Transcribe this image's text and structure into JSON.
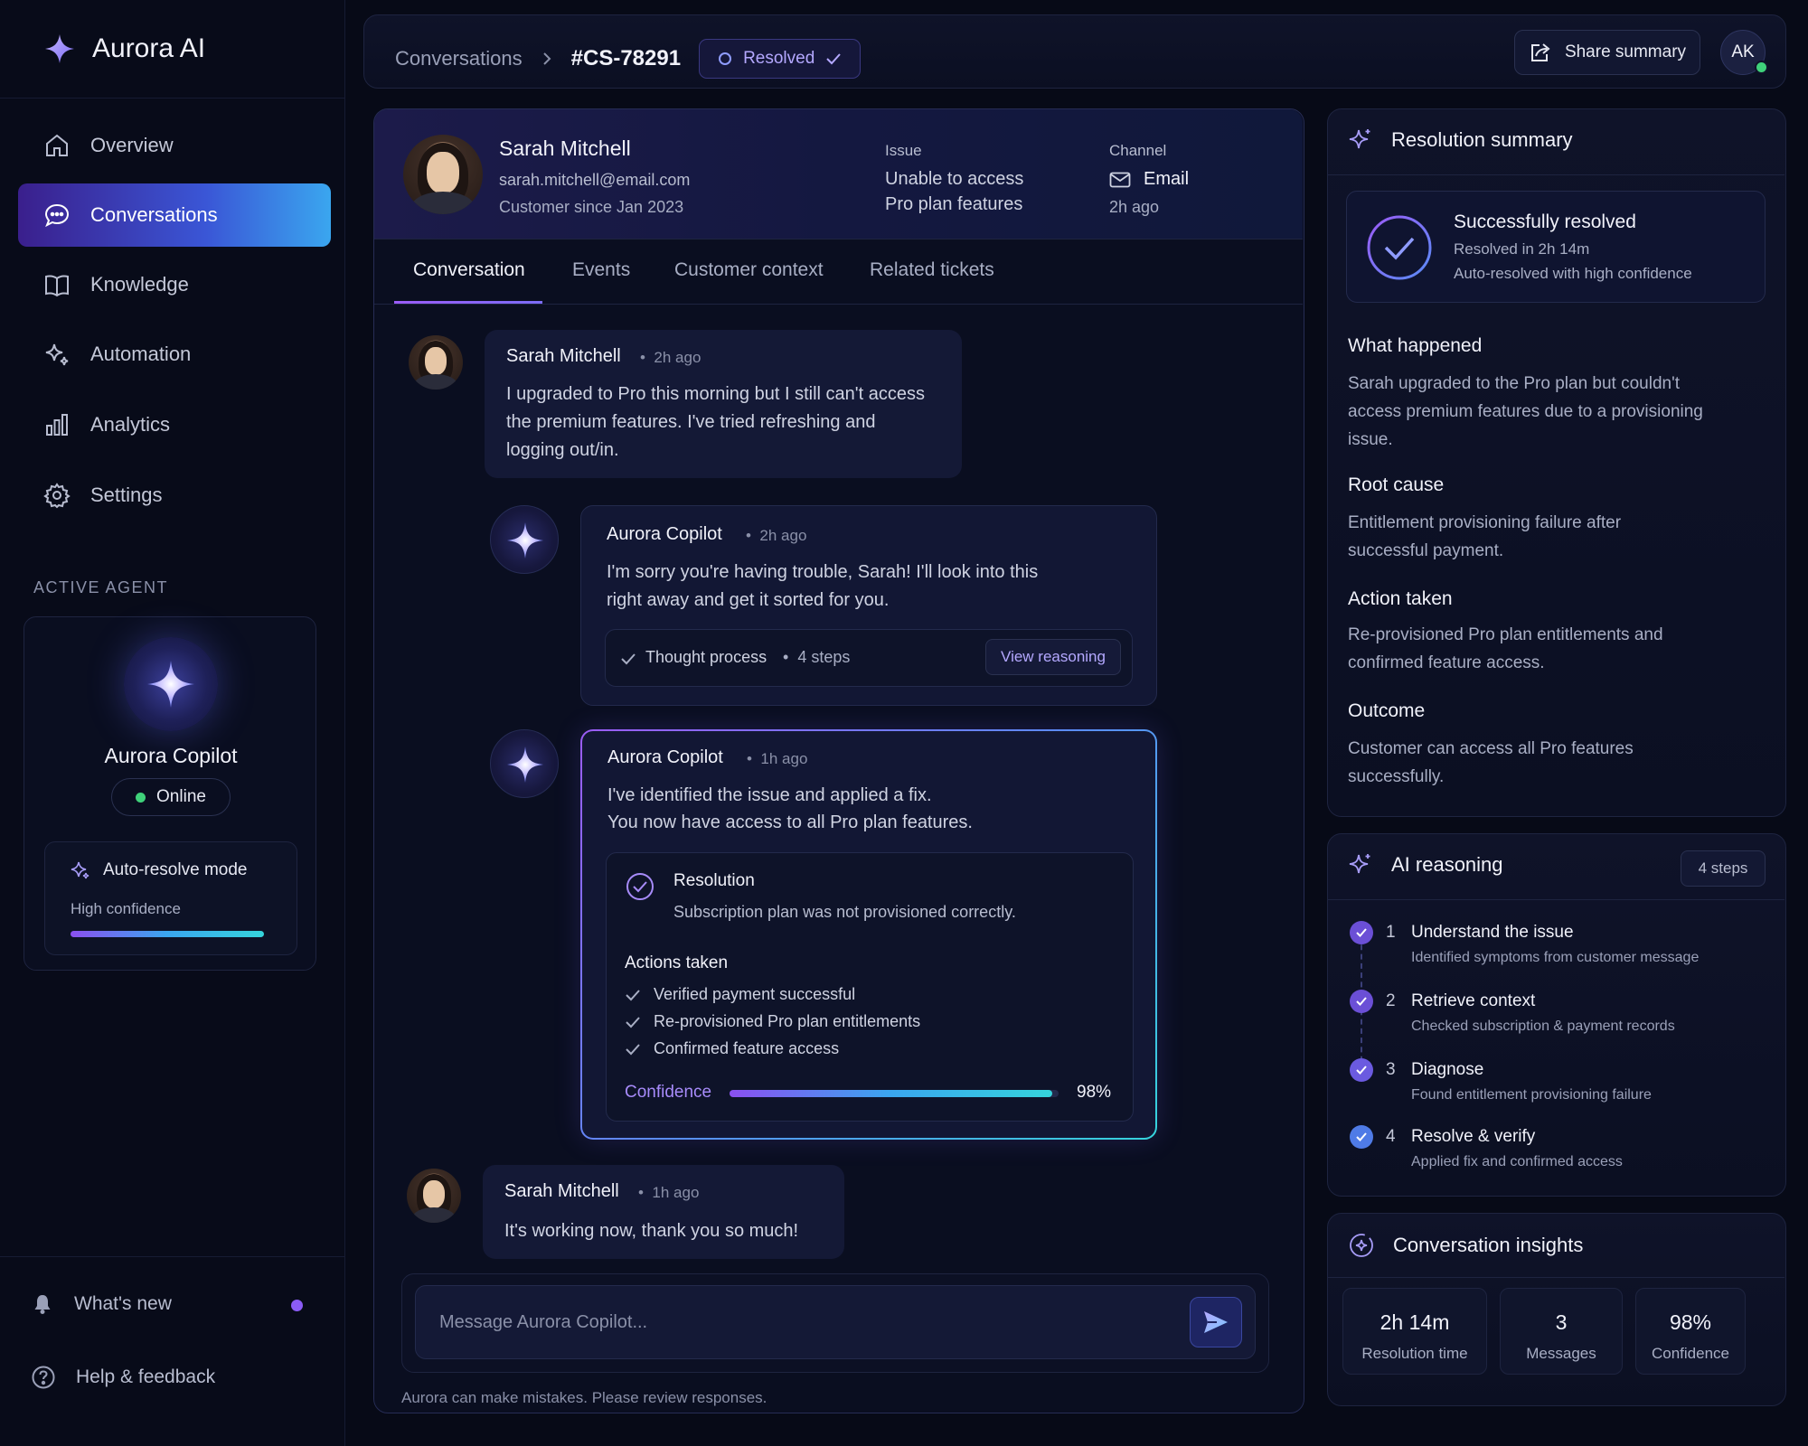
{
  "app": {
    "name": "Aurora AI"
  },
  "sidebar": {
    "items": [
      {
        "label": "Overview",
        "icon": "home-icon"
      },
      {
        "label": "Conversations",
        "icon": "chat-icon"
      },
      {
        "label": "Knowledge",
        "icon": "book-icon"
      },
      {
        "label": "Automation",
        "icon": "sparkle-icon"
      },
      {
        "label": "Analytics",
        "icon": "bar-chart-icon"
      },
      {
        "label": "Settings",
        "icon": "gear-icon"
      }
    ],
    "active_index": 1,
    "active_agent_label": "ACTIVE AGENT",
    "agent": {
      "name": "Aurora Copilot",
      "status": "Online",
      "mode_title": "Auto-resolve mode",
      "mode_sub": "High confidence"
    },
    "whats_new": "What's new",
    "help": "Help & feedback"
  },
  "header": {
    "breadcrumb_root": "Conversations",
    "ticket_id": "#CS-78291",
    "status": "Resolved",
    "share_label": "Share summary",
    "user_initials": "AK"
  },
  "customer": {
    "name": "Sarah Mitchell",
    "email": "sarah.mitchell@email.com",
    "since": "Customer since Jan 2023",
    "issue_label": "Issue",
    "issue_line1": "Unable to access",
    "issue_line2": "Pro plan features",
    "channel_label": "Channel",
    "channel": "Email",
    "channel_time": "2h ago"
  },
  "tabs": [
    "Conversation",
    "Events",
    "Customer context",
    "Related tickets"
  ],
  "messages": {
    "m1": {
      "name": "Sarah Mitchell",
      "time": "2h ago",
      "line1": "I upgraded to Pro this morning but I still can't access",
      "line2": "the premium features. I've tried refreshing and",
      "line3": "logging out/in."
    },
    "m2": {
      "name": "Aurora Copilot",
      "time": "2h ago",
      "line1": "I'm sorry you're having trouble, Sarah! I'll look into this",
      "line2": "right away and get it sorted for you.",
      "thought": "Thought process",
      "steps": "4 steps",
      "view": "View reasoning"
    },
    "m3": {
      "name": "Aurora Copilot",
      "time": "1h ago",
      "line1": "I've identified the issue and applied a fix.",
      "line2": "You now have access to all Pro plan features.",
      "resolution_title": "Resolution",
      "resolution_text": "Subscription plan was not provisioned correctly.",
      "actions_title": "Actions taken",
      "actions": [
        "Verified payment successful",
        "Re-provisioned Pro plan entitlements",
        "Confirmed feature access"
      ],
      "confidence_label": "Confidence",
      "confidence": 0.98,
      "confidence_text": "98%"
    },
    "m4": {
      "name": "Sarah Mitchell",
      "time": "1h ago",
      "text": "It's working now, thank you so much!"
    }
  },
  "composer": {
    "placeholder": "Message Aurora Copilot...",
    "disclaimer": "Aurora can make mistakes. Please review responses."
  },
  "summary": {
    "title": "Resolution summary",
    "status_title": "Successfully resolved",
    "status_time": "Resolved in 2h 14m",
    "status_note": "Auto-resolved with high confidence",
    "sections": [
      {
        "title": "What happened",
        "l1": "Sarah upgraded to the Pro plan but couldn't",
        "l2": "access premium features due to a provisioning",
        "l3": "issue."
      },
      {
        "title": "Root cause",
        "l1": "Entitlement provisioning failure after",
        "l2": "successful payment.",
        "l3": ""
      },
      {
        "title": "Action taken",
        "l1": "Re-provisioned Pro plan entitlements and",
        "l2": "confirmed feature access.",
        "l3": ""
      },
      {
        "title": "Outcome",
        "l1": "Customer can access all Pro features",
        "l2": "successfully.",
        "l3": ""
      }
    ]
  },
  "reasoning": {
    "title": "AI reasoning",
    "badge": "4 steps",
    "steps": [
      {
        "num": "1",
        "title": "Understand the issue",
        "sub": "Identified symptoms from customer message"
      },
      {
        "num": "2",
        "title": "Retrieve context",
        "sub": "Checked subscription & payment records"
      },
      {
        "num": "3",
        "title": "Diagnose",
        "sub": "Found entitlement provisioning failure"
      },
      {
        "num": "4",
        "title": "Resolve & verify",
        "sub": "Applied fix and confirmed access"
      }
    ]
  },
  "insights": {
    "title": "Conversation insights",
    "stats": [
      {
        "value": "2h 14m",
        "label": "Resolution time"
      },
      {
        "value": "3",
        "label": "Messages"
      },
      {
        "value": "98%",
        "label": "Confidence"
      }
    ]
  },
  "colors": {
    "accent": "#8b5cf6",
    "cyan": "#35d4dc",
    "online": "#3fd17a",
    "background": "#070a17"
  }
}
